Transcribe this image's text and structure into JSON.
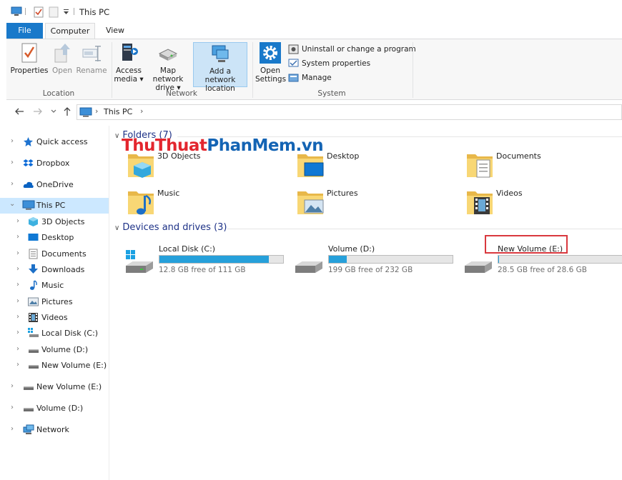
{
  "window": {
    "title": "This PC"
  },
  "ribbon": {
    "tabs": [
      {
        "label": "File"
      },
      {
        "label": "Computer"
      },
      {
        "label": "View"
      }
    ],
    "location": {
      "group_label": "Location",
      "properties": "Properties",
      "open": "Open",
      "rename": "Rename"
    },
    "network": {
      "group_label": "Network",
      "access_media_1": "Access",
      "access_media_2": "media ▾",
      "map_drive_1": "Map network",
      "map_drive_2": "drive ▾",
      "add_location_1": "Add a network",
      "add_location_2": "location"
    },
    "system": {
      "group_label": "System",
      "open_settings_1": "Open",
      "open_settings_2": "Settings",
      "uninstall": "Uninstall or change a program",
      "system_properties": "System properties",
      "manage": "Manage"
    }
  },
  "address": {
    "path": "This PC",
    "back_icon": "arrow-left-icon",
    "forward_icon": "arrow-right-icon",
    "recent_icon": "chevron-down-icon",
    "up_icon": "arrow-up-icon"
  },
  "nav": {
    "items": [
      {
        "label": "Quick access",
        "icon": "star-icon"
      },
      {
        "label": "Dropbox",
        "icon": "dropbox-icon"
      },
      {
        "label": "OneDrive",
        "icon": "cloud-icon"
      },
      {
        "label": "This PC",
        "icon": "computer-icon"
      },
      {
        "label": "3D Objects",
        "icon": "cube-icon"
      },
      {
        "label": "Desktop",
        "icon": "desktop-icon"
      },
      {
        "label": "Documents",
        "icon": "document-icon"
      },
      {
        "label": "Downloads",
        "icon": "download-icon"
      },
      {
        "label": "Music",
        "icon": "music-icon"
      },
      {
        "label": "Pictures",
        "icon": "picture-icon"
      },
      {
        "label": "Videos",
        "icon": "video-icon"
      },
      {
        "label": "Local Disk (C:)",
        "icon": "windows-drive-icon"
      },
      {
        "label": "Volume (D:)",
        "icon": "drive-icon"
      },
      {
        "label": "New Volume (E:)",
        "icon": "drive-icon"
      },
      {
        "label": "New Volume (E:)",
        "icon": "drive-icon"
      },
      {
        "label": "Volume (D:)",
        "icon": "drive-icon"
      },
      {
        "label": "Network",
        "icon": "network-icon"
      }
    ]
  },
  "folders": {
    "header": "Folders (7)",
    "items": [
      {
        "label": "3D Objects"
      },
      {
        "label": "Desktop"
      },
      {
        "label": "Documents"
      },
      {
        "label": "Music"
      },
      {
        "label": "Pictures"
      },
      {
        "label": "Videos"
      }
    ]
  },
  "drives": {
    "header": "Devices and drives (3)",
    "items": [
      {
        "label": "Local Disk (C:)",
        "free": "12.8 GB free of 111 GB",
        "used_fraction": 0.885
      },
      {
        "label": "Volume (D:)",
        "free": "199 GB free of 232 GB",
        "used_fraction": 0.142
      },
      {
        "label": "New Volume (E:)",
        "free": "28.5 GB free of 28.6 GB",
        "used_fraction": 0.004
      }
    ]
  },
  "watermark": {
    "part1": "ThuThuat",
    "part2": "PhanMem",
    "part3": ".vn"
  },
  "colors": {
    "accent": "#1979ca",
    "selection": "#cce8ff",
    "drive_bar": "#26a0da",
    "highlight": "#d9383e"
  }
}
